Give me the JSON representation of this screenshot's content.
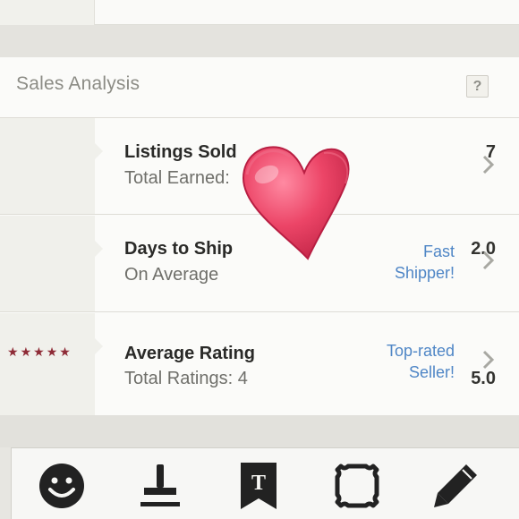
{
  "section": {
    "title": "Sales Analysis",
    "help_label": "?"
  },
  "rows": [
    {
      "value": "7",
      "label": "Listings Sold",
      "sublabel": "Total Earned:",
      "badge_line1": "",
      "badge_line2": ""
    },
    {
      "value": "2.0",
      "label": "Days to Ship",
      "sublabel": "On Average",
      "badge_line1": "Fast",
      "badge_line2": "Shipper!"
    },
    {
      "value": "5.0",
      "label": "Average Rating",
      "sublabel": "Total Ratings: 4",
      "badge_line1": "Top-rated",
      "badge_line2": "Seller!",
      "stars": 5
    }
  ],
  "toolbar": {
    "tools": [
      "smiley-icon",
      "stamp-icon",
      "text-tag-icon",
      "frame-icon",
      "pencil-icon"
    ]
  },
  "colors": {
    "accent_link": "#4f86c6",
    "star": "#8e2b36",
    "heart": "#ec4567"
  }
}
